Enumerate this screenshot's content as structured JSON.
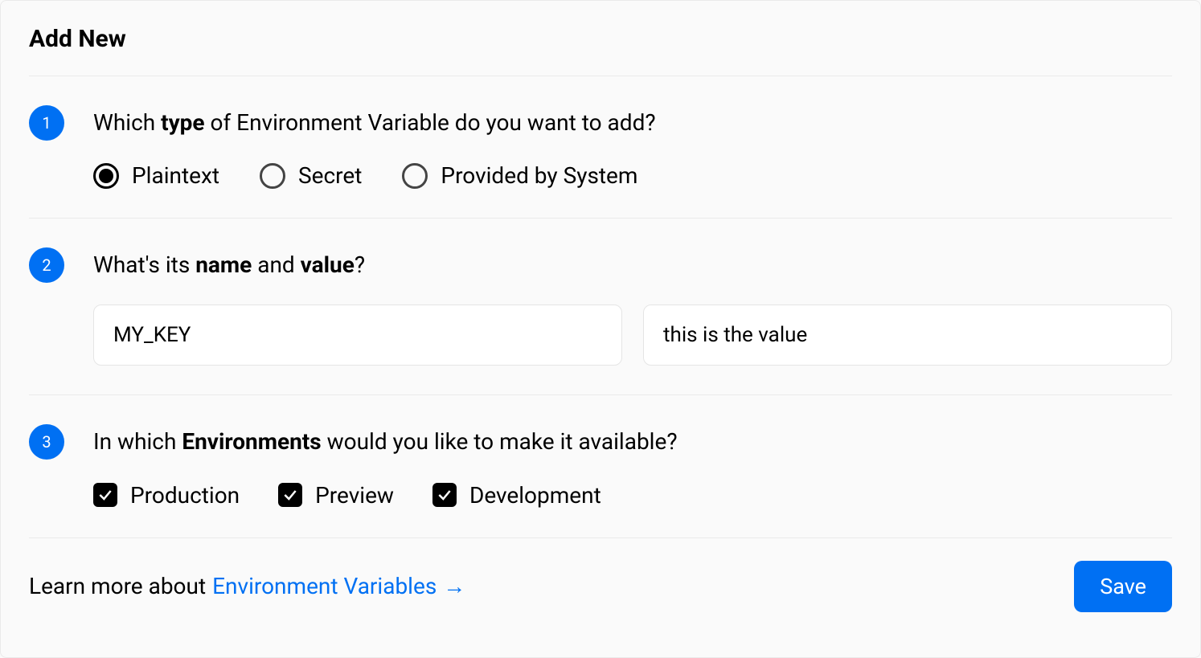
{
  "title": "Add New",
  "accentColor": "#0070f3",
  "steps": {
    "s1": {
      "number": "1",
      "question_pre": "Which ",
      "question_bold": "type",
      "question_post": " of Environment Variable do you want to add?",
      "options": [
        {
          "label": "Plaintext",
          "selected": true
        },
        {
          "label": "Secret",
          "selected": false
        },
        {
          "label": "Provided by System",
          "selected": false
        }
      ]
    },
    "s2": {
      "number": "2",
      "question_pre": "What's its ",
      "question_bold1": "name",
      "question_mid": " and ",
      "question_bold2": "value",
      "question_post": "?",
      "name_value": "MY_KEY",
      "value_value": "this is the value"
    },
    "s3": {
      "number": "3",
      "question_pre": "In which ",
      "question_bold": "Environments",
      "question_post": " would you like to make it available?",
      "environments": [
        {
          "label": "Production",
          "checked": true
        },
        {
          "label": "Preview",
          "checked": true
        },
        {
          "label": "Development",
          "checked": true
        }
      ]
    }
  },
  "footer": {
    "learn_pre": "Learn more about ",
    "learn_link": "Environment Variables",
    "save_label": "Save"
  }
}
